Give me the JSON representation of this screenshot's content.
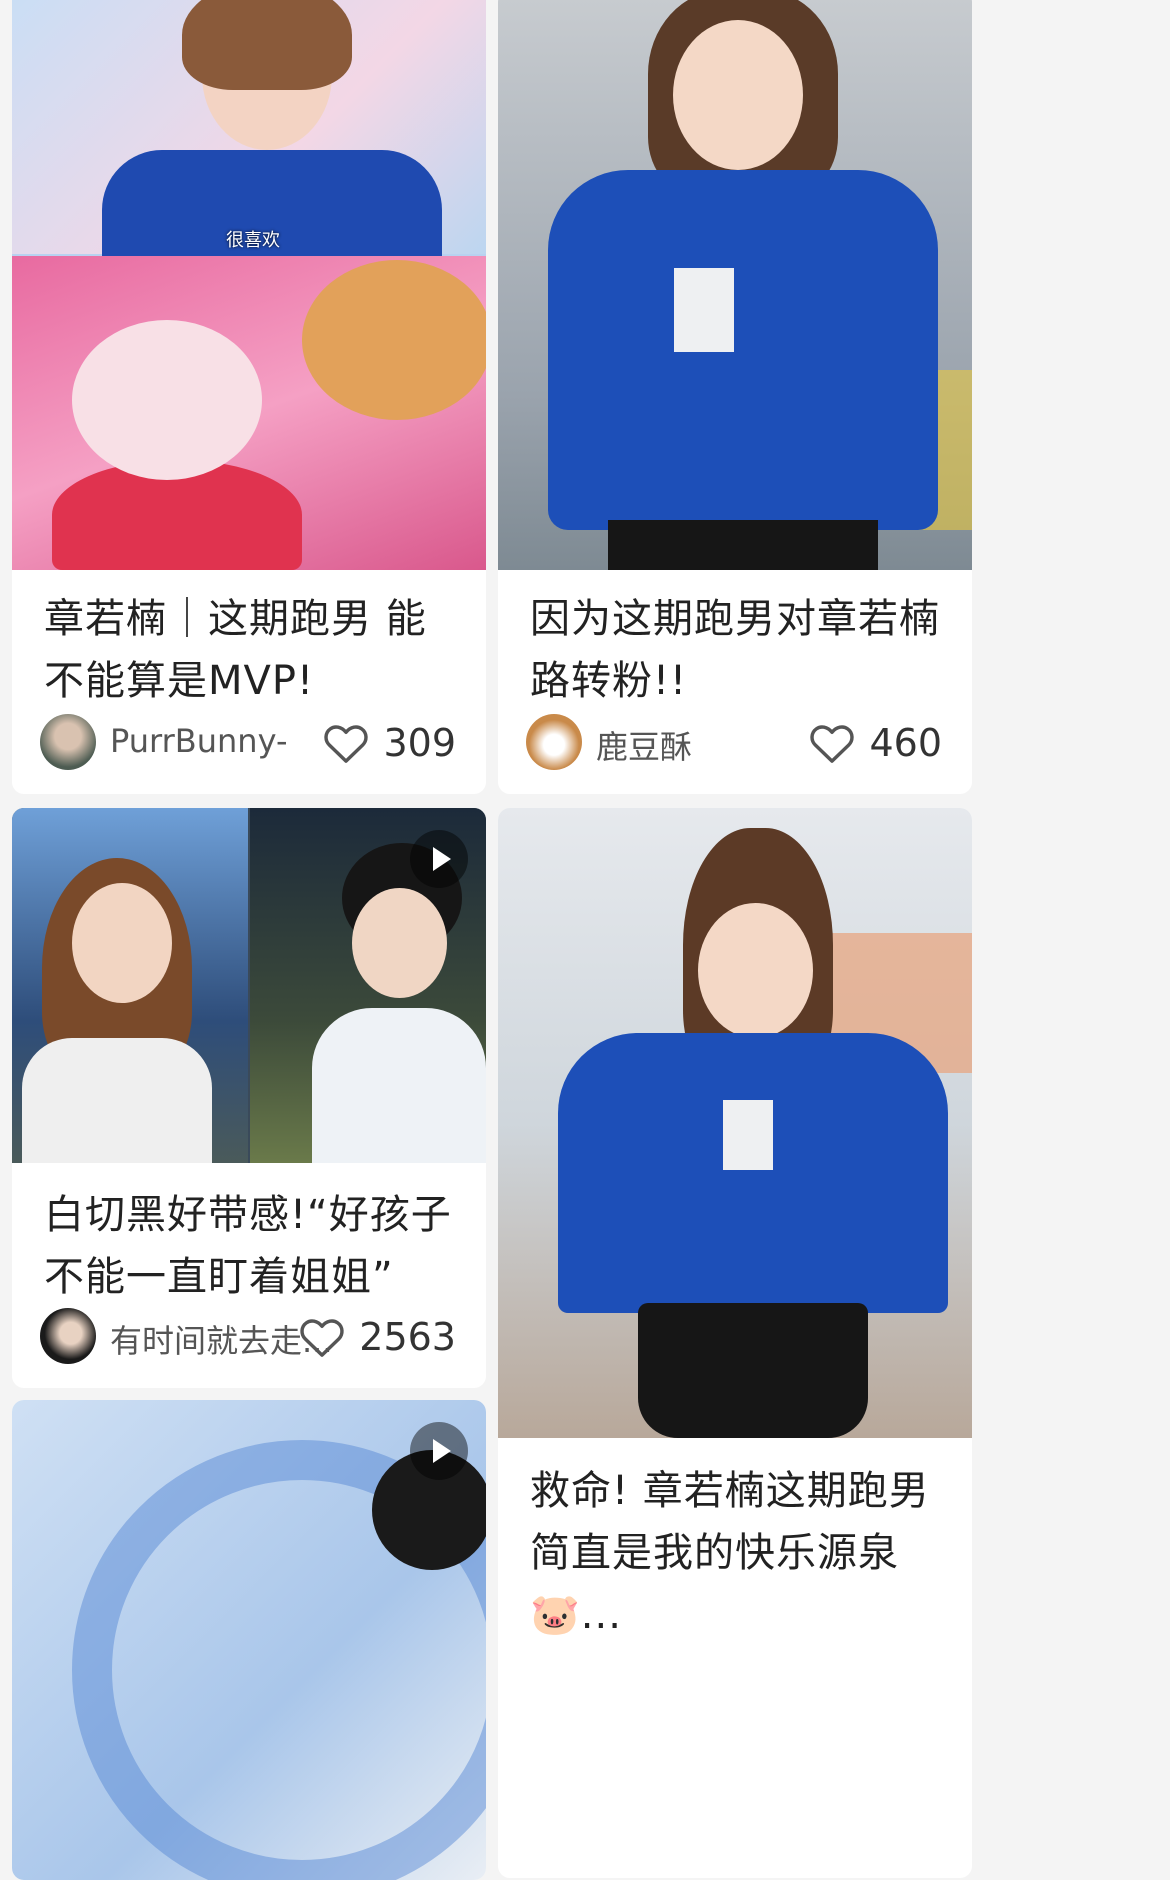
{
  "feed": {
    "cards": [
      {
        "title": "章若楠｜这期跑男 能不能算是MVP!",
        "author": "PurrBunny-",
        "likes": "309",
        "subtitle": "很喜欢"
      },
      {
        "title": "因为这期跑男对章若楠路转粉!!",
        "author": "鹿豆酥",
        "likes": "460"
      },
      {
        "title": "白切黑好带感!“好孩子不能一直盯着姐姐”",
        "author": "有时间就去走...",
        "likes": "2563"
      },
      {
        "title": "救命! 章若楠这期跑男简直是我的快乐源泉🐷..."
      },
      {}
    ]
  },
  "icons": {
    "like": "heart-outline-icon",
    "play": "play-icon"
  },
  "colors": {
    "background": "#f4f4f4",
    "card": "#ffffff",
    "text": "#222222",
    "muted": "#555555",
    "shirt_blue": "#1d4fb8"
  }
}
